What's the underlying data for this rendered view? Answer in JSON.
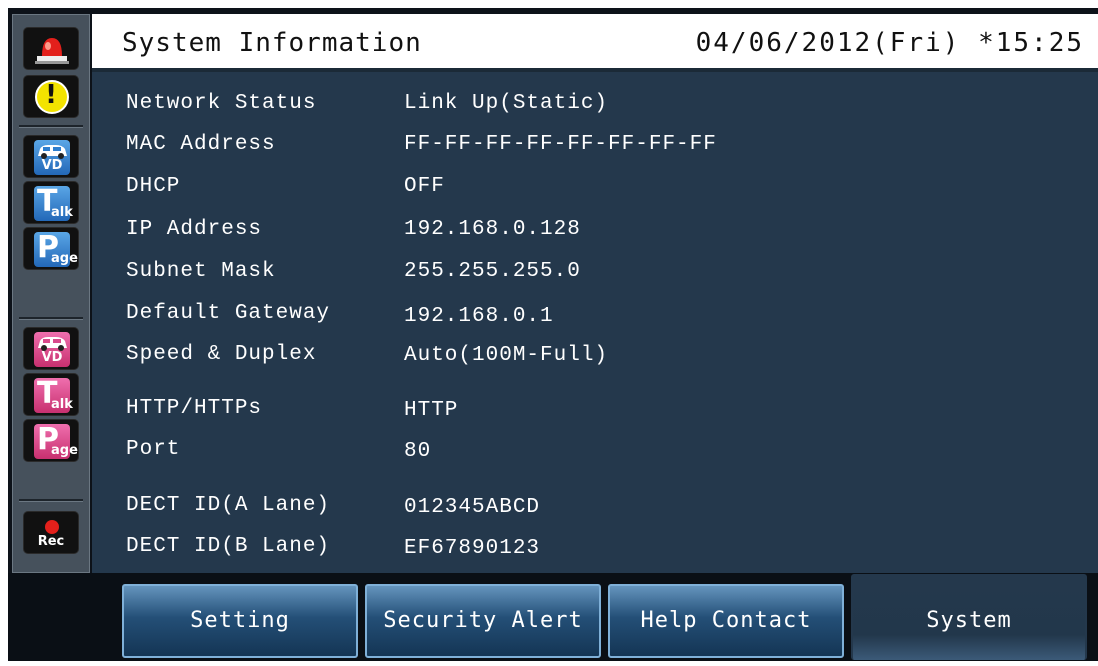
{
  "header": {
    "title": "System Information",
    "datetime": "04/06/2012(Fri) *15:25"
  },
  "sidebar": {
    "items": [
      {
        "icon": "siren-icon"
      },
      {
        "icon": "warning-icon",
        "glyph": "!"
      },
      {
        "icon": "car-vd-icon",
        "label": "VD",
        "color": "#2f7fcf"
      },
      {
        "icon": "talk-icon",
        "letter": "T",
        "label": "alk",
        "color": "#2f7fcf"
      },
      {
        "icon": "page-icon",
        "letter": "P",
        "label": "age",
        "color": "#2f7fcf"
      },
      {
        "icon": "car-vd-icon",
        "label": "VD",
        "color": "#d94a8c"
      },
      {
        "icon": "talk-icon",
        "letter": "T",
        "label": "alk",
        "color": "#d94a8c"
      },
      {
        "icon": "page-icon",
        "letter": "P",
        "label": "age",
        "color": "#d94a8c"
      },
      {
        "icon": "record-icon",
        "label": "Rec"
      }
    ]
  },
  "info": {
    "rows": [
      {
        "label": "Network Status",
        "value": "Link Up(Static)"
      },
      {
        "label": "MAC Address",
        "value": "FF-FF-FF-FF-FF-FF-FF-FF"
      },
      {
        "label": "DHCP",
        "value": "OFF"
      },
      {
        "label": "IP Address",
        "value": "192.168.0.128"
      },
      {
        "label": "Subnet Mask",
        "value": "255.255.255.0"
      },
      {
        "label": "Default Gateway",
        "value": "192.168.0.1"
      },
      {
        "label": "Speed & Duplex",
        "value": "Auto(100M-Full)"
      },
      {
        "label": "HTTP/HTTPs",
        "value": "HTTP"
      },
      {
        "label": "Port",
        "value": "80"
      },
      {
        "label": "DECT ID(A Lane)",
        "value": "012345ABCD"
      },
      {
        "label": "DECT ID(B Lane)",
        "value": "EF67890123"
      }
    ]
  },
  "tabs": [
    {
      "label": "Setting",
      "active": false
    },
    {
      "label": "Security Alert",
      "active": false
    },
    {
      "label": "Help Contact",
      "active": false
    },
    {
      "label": "System",
      "active": true
    }
  ],
  "colors": {
    "panel": "#24384c",
    "tab_blue": "#244f77",
    "blue_icon": "#2f7fcf",
    "pink_icon": "#d94a8c"
  }
}
